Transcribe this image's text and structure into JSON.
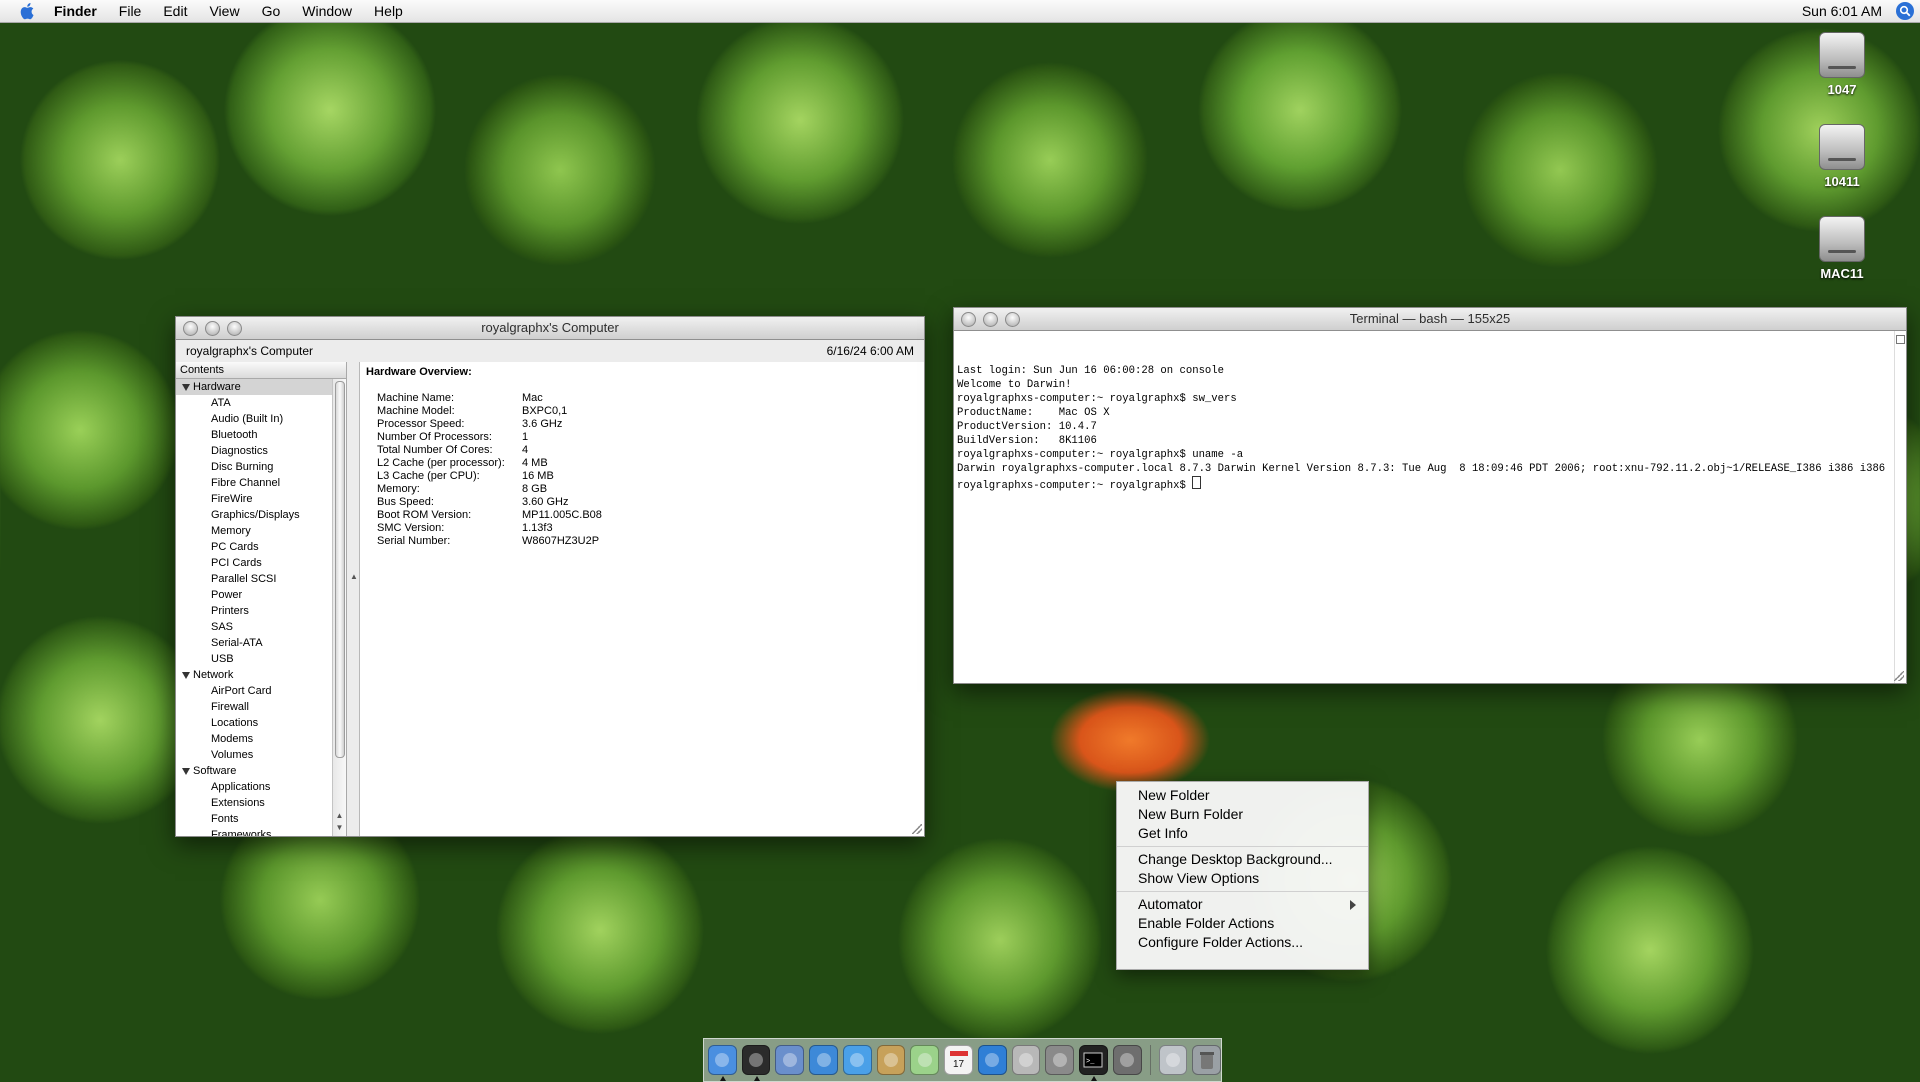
{
  "menubar": {
    "app_name": "Finder",
    "menus": [
      "File",
      "Edit",
      "View",
      "Go",
      "Window",
      "Help"
    ],
    "clock": "Sun 6:01 AM"
  },
  "desktop_icons": [
    "1047",
    "10411",
    "MAC11"
  ],
  "profiler": {
    "title": "royalgraphx's Computer",
    "computer_name": "royalgraphx's Computer",
    "date": "6/16/24 6:00 AM",
    "contents_header": "Contents",
    "groups": [
      {
        "name": "Hardware",
        "items": [
          "ATA",
          "Audio (Built In)",
          "Bluetooth",
          "Diagnostics",
          "Disc Burning",
          "Fibre Channel",
          "FireWire",
          "Graphics/Displays",
          "Memory",
          "PC Cards",
          "PCI Cards",
          "Parallel SCSI",
          "Power",
          "Printers",
          "SAS",
          "Serial-ATA",
          "USB"
        ]
      },
      {
        "name": "Network",
        "items": [
          "AirPort Card",
          "Firewall",
          "Locations",
          "Modems",
          "Volumes"
        ]
      },
      {
        "name": "Software",
        "items": [
          "Applications",
          "Extensions",
          "Fonts",
          "Frameworks"
        ]
      }
    ],
    "overview_title": "Hardware Overview:",
    "overview": [
      {
        "key": "Machine Name:",
        "value": "Mac"
      },
      {
        "key": "Machine Model:",
        "value": "BXPC0,1"
      },
      {
        "key": "Processor Speed:",
        "value": "3.6 GHz"
      },
      {
        "key": "Number Of Processors:",
        "value": "1"
      },
      {
        "key": "Total Number Of Cores:",
        "value": "4"
      },
      {
        "key": "L2 Cache (per processor):",
        "value": "4 MB"
      },
      {
        "key": "L3 Cache (per CPU):",
        "value": "16 MB"
      },
      {
        "key": "Memory:",
        "value": "8 GB"
      },
      {
        "key": "Bus Speed:",
        "value": "3.60 GHz"
      },
      {
        "key": "Boot ROM Version:",
        "value": "MP11.005C.B08"
      },
      {
        "key": "SMC Version:",
        "value": "1.13f3"
      },
      {
        "key": "Serial Number:",
        "value": "W8607HZ3U2P"
      }
    ]
  },
  "terminal": {
    "title": "Terminal — bash — 155x25",
    "lines": [
      "Last login: Sun Jun 16 06:00:28 on console",
      "Welcome to Darwin!",
      "royalgraphxs-computer:~ royalgraphx$ sw_vers",
      "ProductName:    Mac OS X",
      "ProductVersion: 10.4.7",
      "BuildVersion:   8K1106",
      "royalgraphxs-computer:~ royalgraphx$ uname -a",
      "Darwin royalgraphxs-computer.local 8.7.3 Darwin Kernel Version 8.7.3: Tue Aug  8 18:09:46 PDT 2006; root:xnu-792.11.2.obj~1/RELEASE_I386 i386 i386"
    ],
    "prompt": "royalgraphxs-computer:~ royalgraphx$ "
  },
  "context_menu": {
    "groups": [
      [
        "New Folder",
        "New Burn Folder",
        "Get Info"
      ],
      [
        "Change Desktop Background...",
        "Show View Options"
      ],
      [
        "Automator",
        "Enable Folder Actions",
        "Configure Folder Actions..."
      ]
    ],
    "submenu_item": "Automator"
  },
  "dock": {
    "icons": [
      "finder-icon",
      "dashboard-icon",
      "mail-icon",
      "safari-icon",
      "ichat-icon",
      "address-book-icon",
      "itunes-icon",
      "ical-icon",
      "quicktime-icon",
      "system-preferences-icon",
      "network-utility-icon",
      "terminal-icon",
      "activity-monitor-icon",
      "documents-stack-icon",
      "trash-icon"
    ]
  }
}
